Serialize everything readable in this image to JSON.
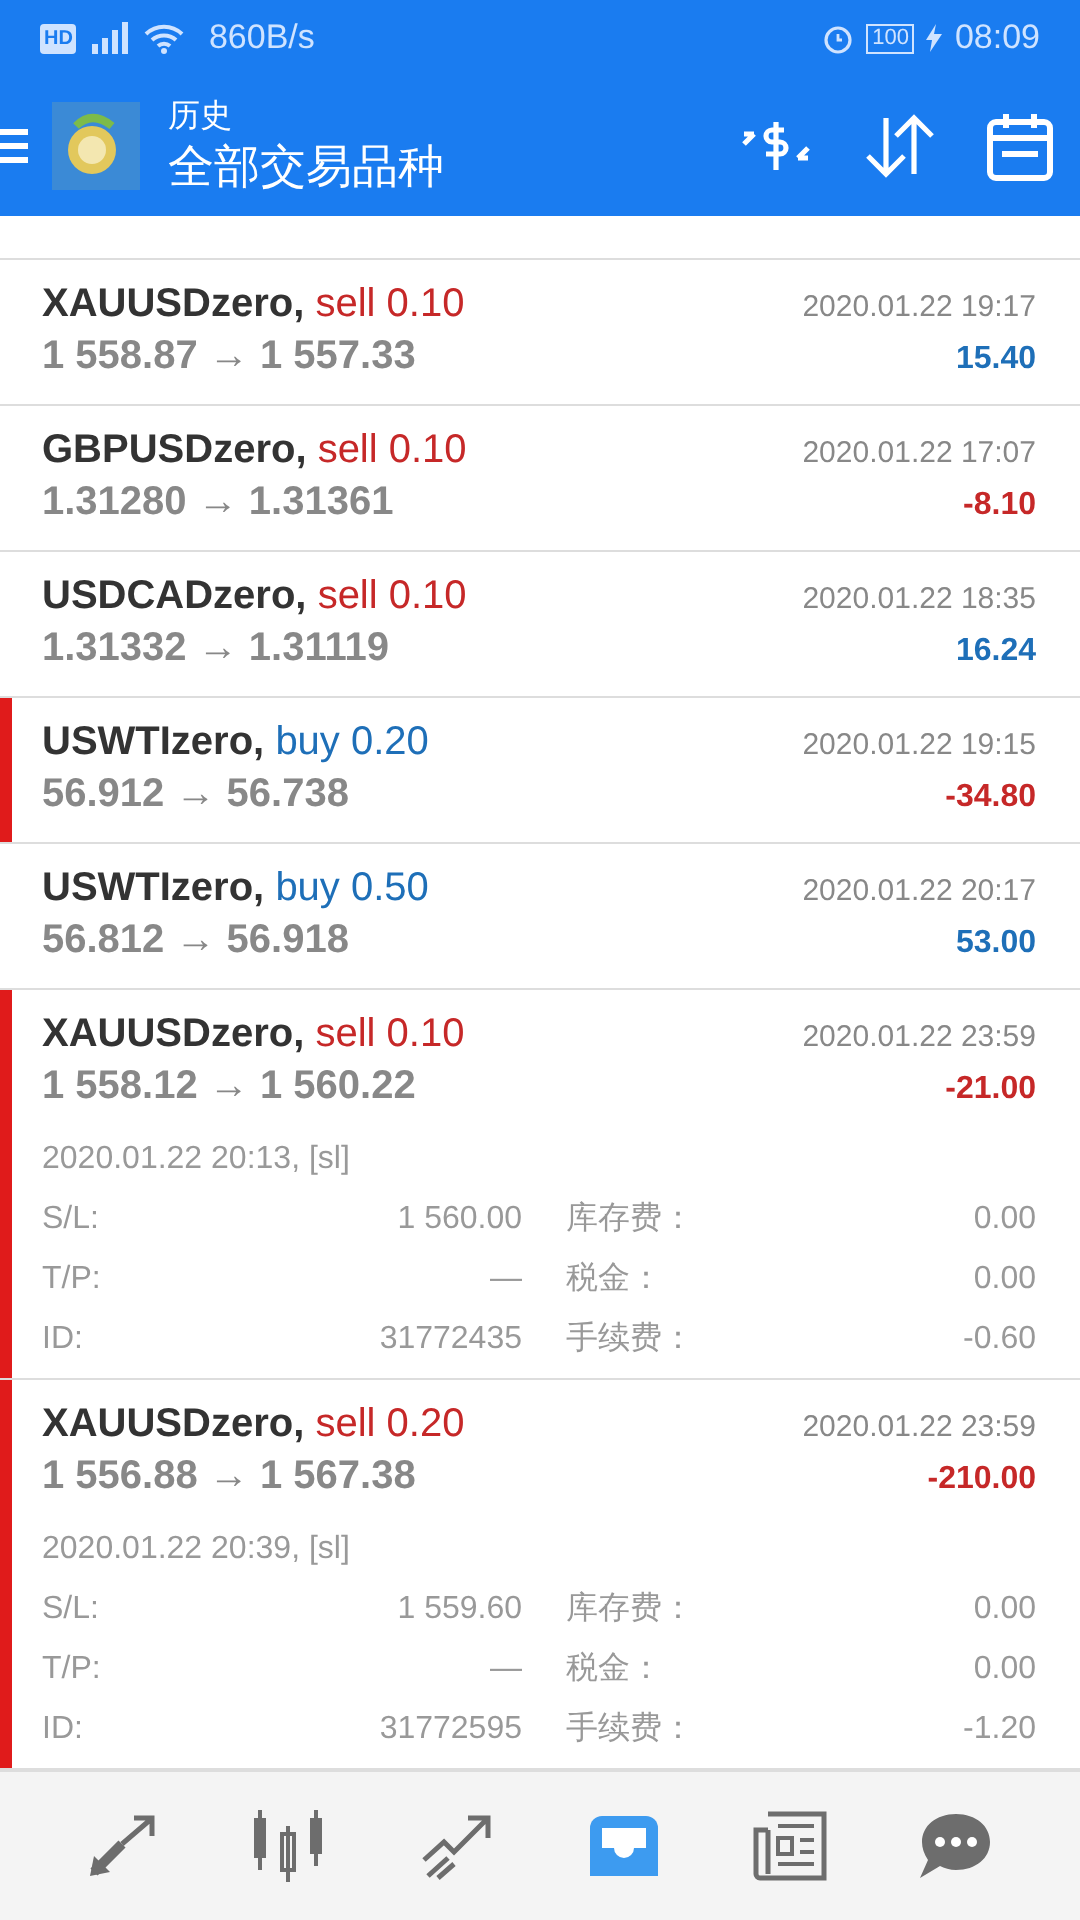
{
  "status_bar": {
    "network_badge": "HD",
    "speed": "860B/s",
    "battery": "100",
    "time": "08:09"
  },
  "header": {
    "title": "历史",
    "subtitle": "全部交易品种"
  },
  "trades": [
    {
      "symbol": "XAUUSDzero,",
      "side": "sell",
      "lots": "0.10",
      "prices": "1 558.87 → 1 557.33",
      "time": "2020.01.22 19:17",
      "profit": "15.40",
      "loss": false,
      "marked": false,
      "expanded": false
    },
    {
      "symbol": "GBPUSDzero,",
      "side": "sell",
      "lots": "0.10",
      "prices": "1.31280 → 1.31361",
      "time": "2020.01.22 17:07",
      "profit": "-8.10",
      "loss": true,
      "marked": false,
      "expanded": false
    },
    {
      "symbol": "USDCADzero,",
      "side": "sell",
      "lots": "0.10",
      "prices": "1.31332 → 1.31119",
      "time": "2020.01.22 18:35",
      "profit": "16.24",
      "loss": false,
      "marked": false,
      "expanded": false
    },
    {
      "symbol": "USWTIzero,",
      "side": "buy",
      "lots": "0.20",
      "prices": "56.912 → 56.738",
      "time": "2020.01.22 19:15",
      "profit": "-34.80",
      "loss": true,
      "marked": true,
      "expanded": false
    },
    {
      "symbol": "USWTIzero,",
      "side": "buy",
      "lots": "0.50",
      "prices": "56.812 → 56.918",
      "time": "2020.01.22 20:17",
      "profit": "53.00",
      "loss": false,
      "marked": false,
      "expanded": false
    },
    {
      "symbol": "XAUUSDzero,",
      "side": "sell",
      "lots": "0.10",
      "prices": "1 558.12 → 1 560.22",
      "time": "2020.01.22 23:59",
      "profit": "-21.00",
      "loss": true,
      "marked": true,
      "expanded": true,
      "close_info": "2020.01.22 20:13, [sl]",
      "fields": [
        {
          "label": "S/L:",
          "value": "1 560.00"
        },
        {
          "label": "库存费：",
          "value": "0.00"
        },
        {
          "label": "T/P:",
          "value": "—"
        },
        {
          "label": "税金：",
          "value": "0.00"
        },
        {
          "label": "ID:",
          "value": "31772435"
        },
        {
          "label": "手续费：",
          "value": "-0.60"
        }
      ]
    },
    {
      "symbol": "XAUUSDzero,",
      "side": "sell",
      "lots": "0.20",
      "prices": "1 556.88 → 1 567.38",
      "time": "2020.01.22 23:59",
      "profit": "-210.00",
      "loss": true,
      "marked": true,
      "expanded": true,
      "close_info": "2020.01.22 20:39, [sl]",
      "fields": [
        {
          "label": "S/L:",
          "value": "1 559.60"
        },
        {
          "label": "库存费：",
          "value": "0.00"
        },
        {
          "label": "T/P:",
          "value": "—"
        },
        {
          "label": "税金：",
          "value": "0.00"
        },
        {
          "label": "ID:",
          "value": "31772595"
        },
        {
          "label": "手续费：",
          "value": "-1.20"
        }
      ]
    }
  ],
  "bottom_nav": [
    {
      "kind": "trade",
      "selected": false
    },
    {
      "kind": "chart",
      "selected": false
    },
    {
      "kind": "analytics",
      "selected": false
    },
    {
      "kind": "history",
      "selected": true
    },
    {
      "kind": "news",
      "selected": false
    },
    {
      "kind": "chat",
      "selected": false
    }
  ]
}
